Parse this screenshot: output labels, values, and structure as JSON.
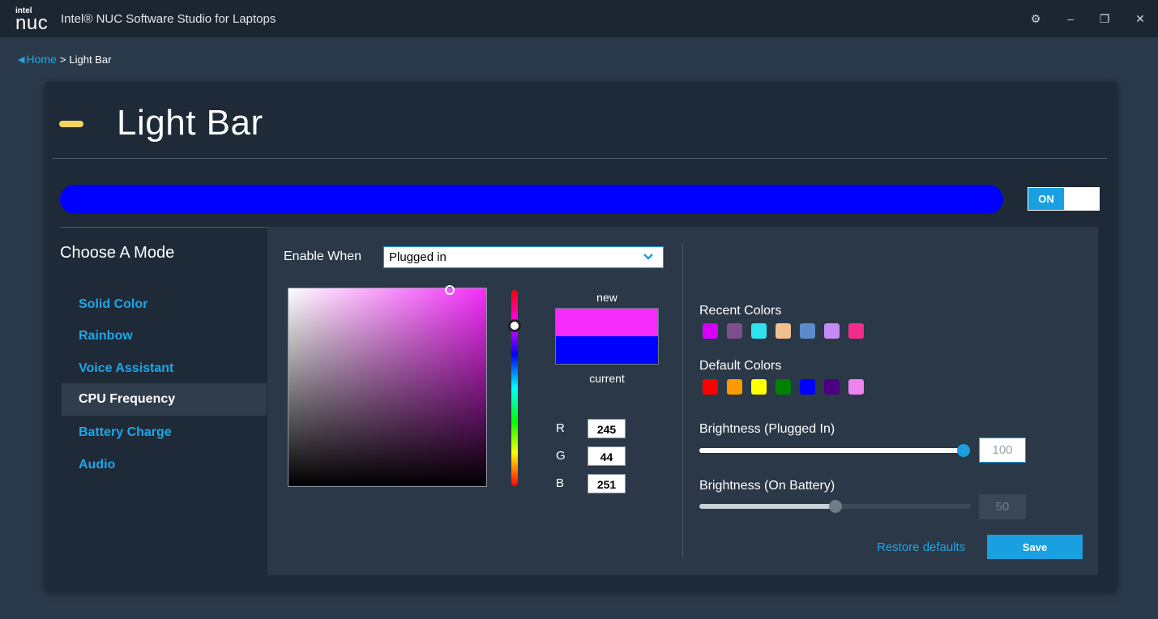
{
  "app": {
    "logo_small": "intel",
    "logo_big": "nuc",
    "title": "Intel® NUC Software Studio for Laptops"
  },
  "window_controls": {
    "settings_glyph": "⚙",
    "minimize_glyph": "–",
    "restore_glyph": "❐",
    "close_glyph": "✕"
  },
  "breadcrumb": {
    "back_glyph": "◀",
    "home": "Home",
    "separator": ">",
    "current": "Light Bar"
  },
  "page": {
    "title": "Light Bar",
    "accent_color": "#f6d35a",
    "preview_color": "#0000ff",
    "power_toggle": {
      "label": "ON",
      "state": "on"
    }
  },
  "modes": {
    "title": "Choose A Mode",
    "items": [
      {
        "label": "Solid Color",
        "active": false
      },
      {
        "label": "Rainbow",
        "active": false
      },
      {
        "label": "Voice Assistant",
        "active": false
      },
      {
        "label": "CPU Frequency",
        "active": true
      },
      {
        "label": "Battery Charge",
        "active": false
      },
      {
        "label": "Audio",
        "active": false
      }
    ]
  },
  "enable_when": {
    "label": "Enable When",
    "value": "Plugged in"
  },
  "color_picker": {
    "new_label": "new",
    "current_label": "current",
    "new_color": "#f52cfb",
    "current_color": "#0000ff",
    "r_label": "R",
    "g_label": "G",
    "b_label": "B",
    "r": "245",
    "g": "44",
    "b": "251"
  },
  "recent_colors": {
    "label": "Recent Colors",
    "colors": [
      "#d500f9",
      "#7e4e8e",
      "#2ee3ee",
      "#f0c08e",
      "#5b8cc9",
      "#c58af5",
      "#f02e8a"
    ]
  },
  "default_colors": {
    "label": "Default Colors",
    "colors": [
      "#ff0000",
      "#ff9900",
      "#ffff00",
      "#008000",
      "#0000ff",
      "#4b0082",
      "#ee82ee"
    ]
  },
  "brightness_plugged": {
    "label": "Brightness (Plugged In)",
    "value": "100",
    "fraction": 1.0,
    "enabled": true
  },
  "brightness_battery": {
    "label": "Brightness (On Battery)",
    "value": "50",
    "fraction": 0.5,
    "enabled": false
  },
  "actions": {
    "restore": "Restore defaults",
    "save": "Save"
  }
}
